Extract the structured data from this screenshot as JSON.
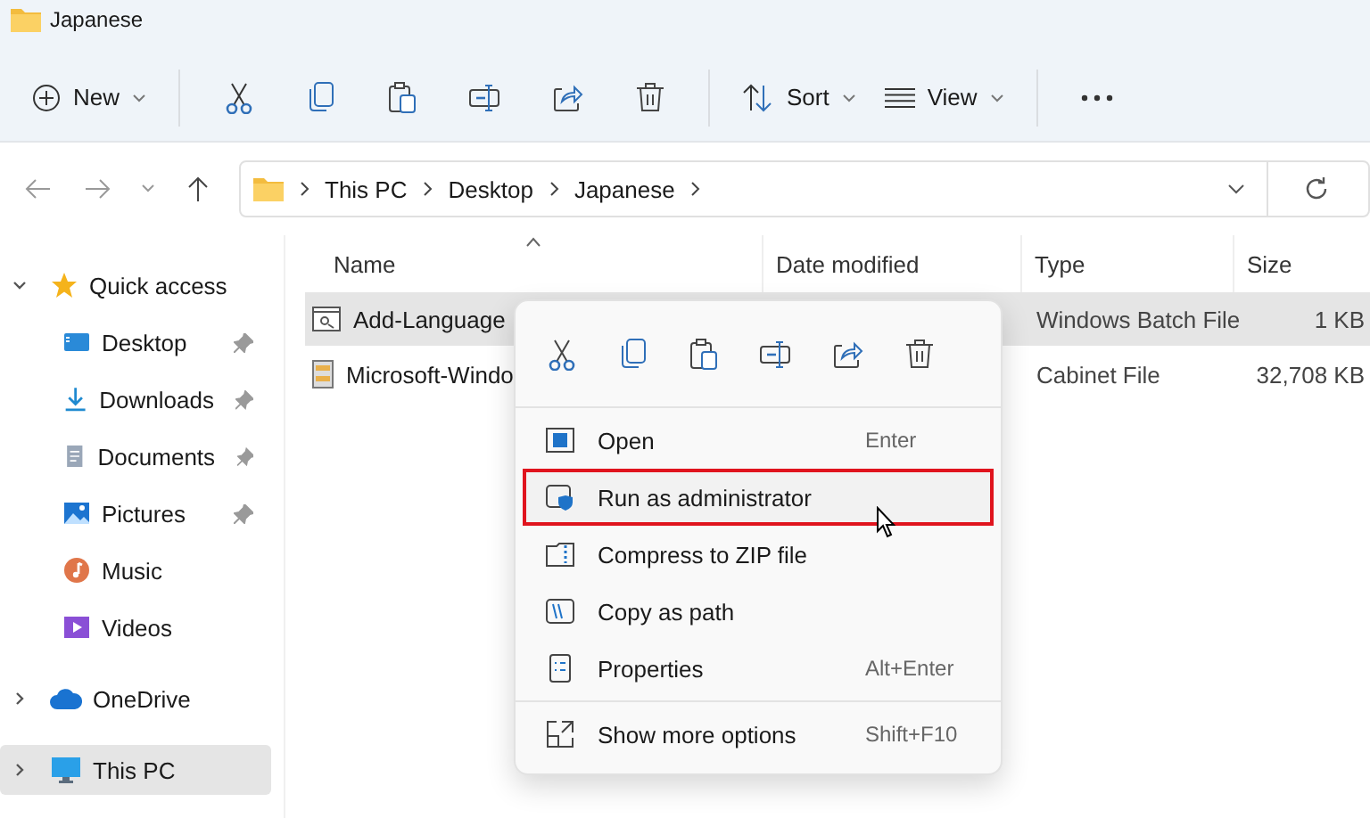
{
  "window": {
    "title": "Japanese"
  },
  "toolbar": {
    "new_label": "New",
    "sort_label": "Sort",
    "view_label": "View"
  },
  "address": {
    "path": [
      "This PC",
      "Desktop",
      "Japanese"
    ]
  },
  "sidebar": [
    {
      "label": "Quick access",
      "kind": "star",
      "expanded": true,
      "selected": false,
      "children": [
        {
          "label": "Desktop",
          "kind": "desktop",
          "pinned": true,
          "selected": false
        },
        {
          "label": "Downloads",
          "kind": "download",
          "pinned": true,
          "selected": false
        },
        {
          "label": "Documents",
          "kind": "document",
          "pinned": true,
          "selected": false
        },
        {
          "label": "Pictures",
          "kind": "pictures",
          "pinned": true,
          "selected": false
        },
        {
          "label": "Music",
          "kind": "music",
          "pinned": false,
          "selected": false
        },
        {
          "label": "Videos",
          "kind": "videos",
          "pinned": false,
          "selected": false
        }
      ]
    },
    {
      "label": "OneDrive",
      "kind": "cloud",
      "expanded": false,
      "selected": false
    },
    {
      "label": "This PC",
      "kind": "pc",
      "expanded": false,
      "selected": true
    }
  ],
  "columns": [
    {
      "label": "Name",
      "sorted": true
    },
    {
      "label": "Date modified",
      "sorted": false
    },
    {
      "label": "Type",
      "sorted": false
    },
    {
      "label": "Size",
      "sorted": false
    }
  ],
  "rows": [
    {
      "name": "Add-Language",
      "kind": "batch",
      "type": "Windows Batch File",
      "size": "1 KB",
      "selected": true
    },
    {
      "name": "Microsoft-Windo",
      "kind": "cabinet",
      "type": "Cabinet File",
      "size": "32,708 KB",
      "selected": false
    }
  ],
  "context_menu": {
    "items": [
      {
        "label": "Open",
        "kind": "open",
        "shortcut": "Enter",
        "highlighted": false
      },
      {
        "label": "Run as administrator",
        "kind": "admin",
        "highlighted": true
      },
      {
        "label": "Compress to ZIP file",
        "kind": "zip",
        "highlighted": false
      },
      {
        "label": "Copy as path",
        "kind": "path",
        "highlighted": false
      },
      {
        "label": "Properties",
        "kind": "properties",
        "shortcut": "Alt+Enter",
        "highlighted": false
      }
    ],
    "more_options": {
      "label": "Show more options",
      "shortcut": "Shift+F10"
    }
  }
}
